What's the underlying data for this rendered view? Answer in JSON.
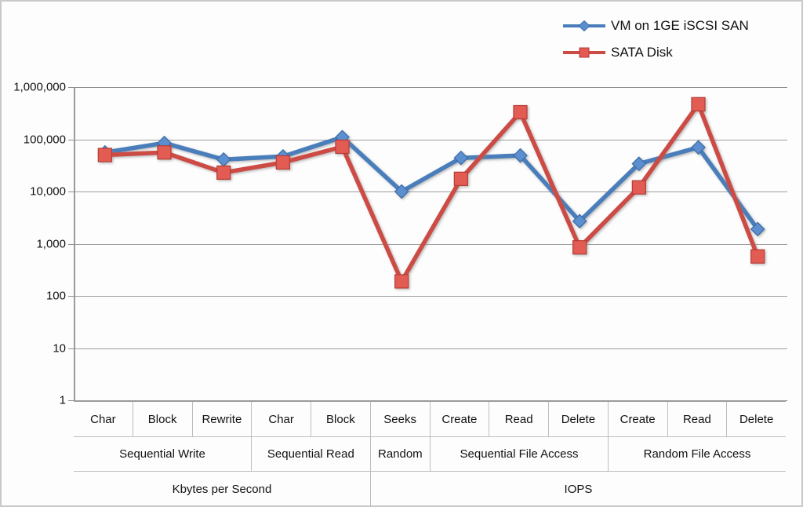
{
  "legend": {
    "position": "top-right",
    "items": [
      {
        "label": "VM on 1GE iSCSI SAN",
        "color": "#4a7ebb",
        "marker": "diamond"
      },
      {
        "label": "SATA Disk",
        "color": "#cc4b45",
        "marker": "square"
      }
    ]
  },
  "axis": {
    "y": {
      "scale": "log",
      "min": 1,
      "max": 1000000,
      "ticks": [
        "1,000,000",
        "100,000",
        "10,000",
        "1,000",
        "100",
        "10",
        "1"
      ],
      "tick_values": [
        1000000,
        100000,
        10000,
        1000,
        100,
        10,
        1
      ]
    }
  },
  "xaxis": {
    "level1": [
      "Char",
      "Block",
      "Rewrite",
      "Char",
      "Block",
      "Seeks",
      "Create",
      "Read",
      "Delete",
      "Create",
      "Read",
      "Delete"
    ],
    "level2": [
      {
        "label": "Sequential Write",
        "span": 3
      },
      {
        "label": "Sequential Read",
        "span": 2
      },
      {
        "label": "Random",
        "span": 1
      },
      {
        "label": "Sequential File Access",
        "span": 3
      },
      {
        "label": "Random File Access",
        "span": 3
      }
    ],
    "level3": [
      {
        "label": "Kbytes per Second",
        "span": 5
      },
      {
        "label": "IOPS",
        "span": 7
      }
    ]
  },
  "chart_data": {
    "type": "line",
    "title": "",
    "xlabel": "",
    "ylabel": "",
    "ylim": [
      1,
      1000000
    ],
    "yscale": "log",
    "grid": true,
    "legend_position": "top-right",
    "categories": [
      "Char",
      "Block",
      "Rewrite",
      "Char",
      "Block",
      "Seeks",
      "Create",
      "Read",
      "Delete",
      "Create",
      "Read",
      "Delete"
    ],
    "category_groups": [
      "Sequential Write",
      "Sequential Write",
      "Sequential Write",
      "Sequential Read",
      "Sequential Read",
      "Random",
      "Sequential File Access",
      "Sequential File Access",
      "Sequential File Access",
      "Random File Access",
      "Random File Access",
      "Random File Access"
    ],
    "category_units": [
      "Kbytes per Second",
      "Kbytes per Second",
      "Kbytes per Second",
      "Kbytes per Second",
      "Kbytes per Second",
      "IOPS",
      "IOPS",
      "IOPS",
      "IOPS",
      "IOPS",
      "IOPS",
      "IOPS"
    ],
    "series": [
      {
        "name": "VM on 1GE iSCSI SAN",
        "color": "#4a7ebb",
        "marker": "diamond",
        "values": [
          56000,
          85000,
          41000,
          47000,
          110000,
          10000,
          44000,
          49000,
          2700,
          34000,
          70000,
          1900
        ]
      },
      {
        "name": "SATA Disk",
        "color": "#cc4b45",
        "marker": "square",
        "values": [
          50000,
          56000,
          23000,
          36000,
          72000,
          190,
          17500,
          330000,
          850,
          12000,
          470000,
          570
        ]
      }
    ]
  }
}
